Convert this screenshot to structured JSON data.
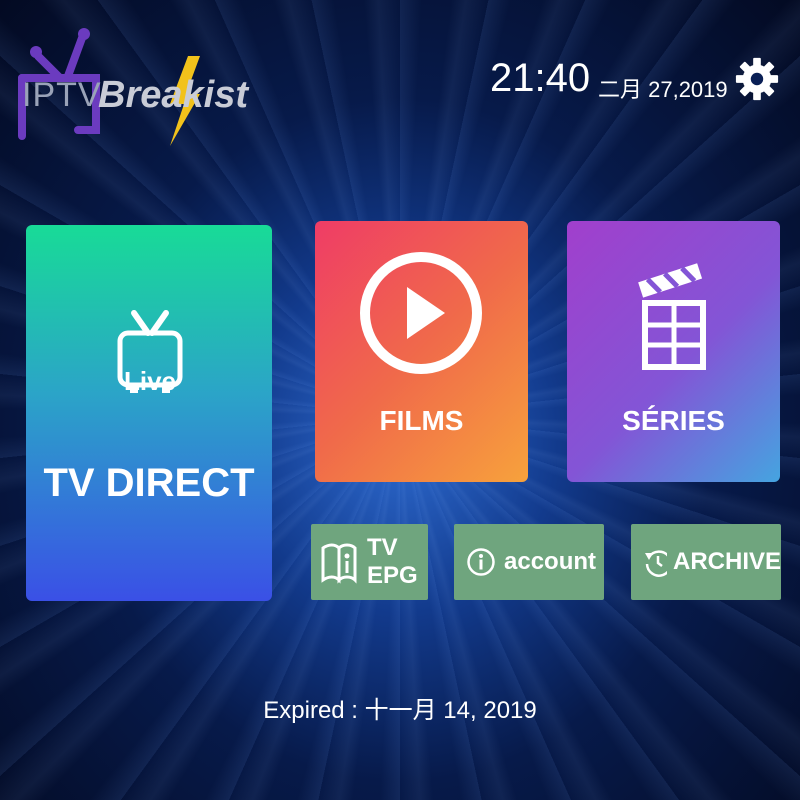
{
  "brand": {
    "word1": "IPTV",
    "word2": "Breakist"
  },
  "header": {
    "time": "21:40",
    "date": "二月 27,2019"
  },
  "tiles": {
    "tv_direct": {
      "badge": "Live",
      "label": "TV DIRECT"
    },
    "films": {
      "label": "FILMS"
    },
    "series": {
      "label": "SÉRIES"
    }
  },
  "buttons": {
    "epg_line1": "TV",
    "epg_line2": "EPG",
    "account": "account",
    "archive": "ARCHIVE"
  },
  "footer": {
    "expired": "Expired : 十一月 14, 2019"
  },
  "colors": {
    "tv_direct_top": "#18db97",
    "tv_direct_bottom": "#3a50e6",
    "films_start": "#ef3c66",
    "films_end": "#f7a23c",
    "series_start": "#a13fcc",
    "series_end": "#45a4e0",
    "button_bg": "#6fa57e",
    "bolt": "#f2c21b",
    "antenna": "#6b3bbf"
  }
}
